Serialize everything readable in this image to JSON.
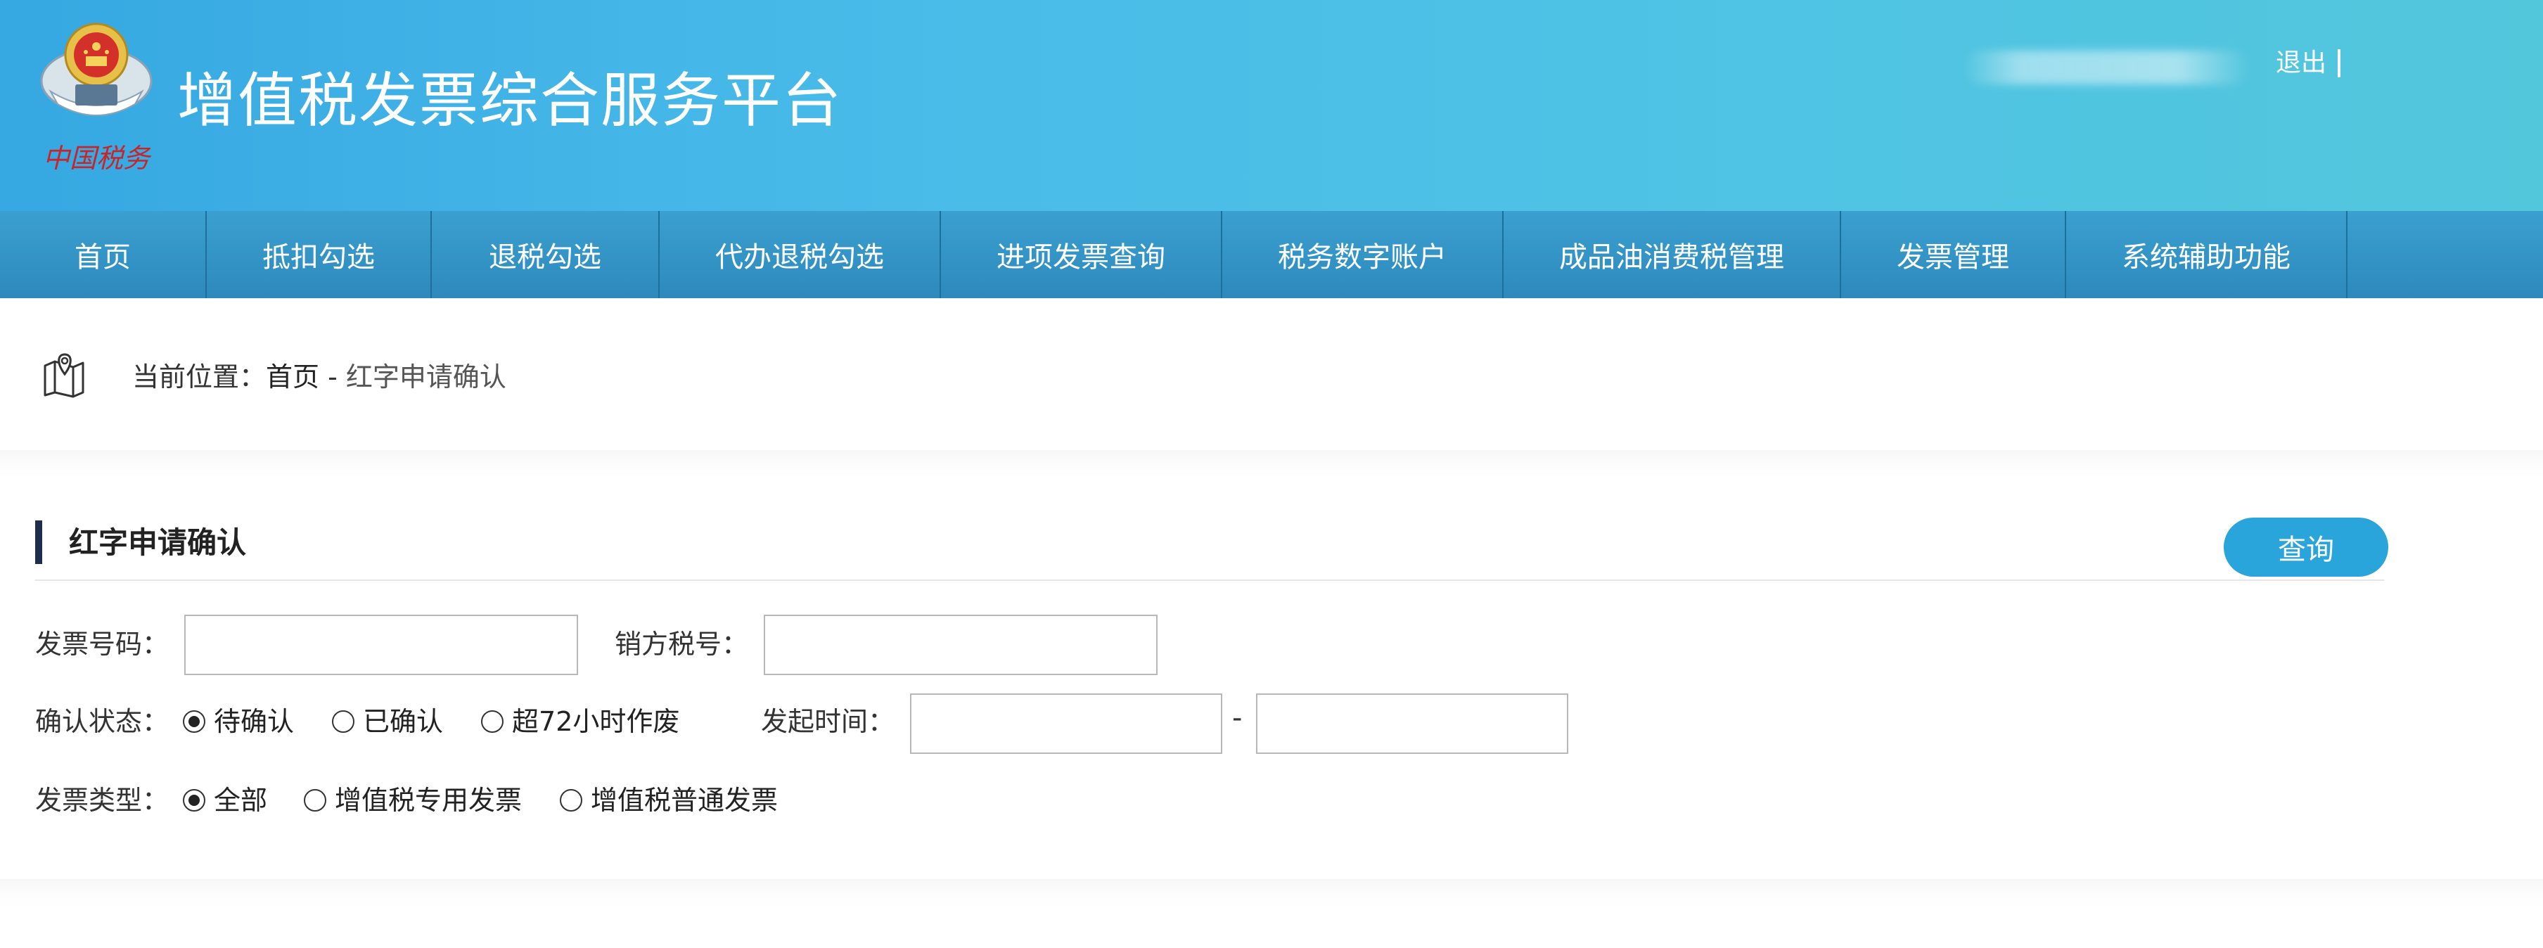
{
  "header": {
    "title": "增值税发票综合服务平台",
    "emblem_icon": "national-tax-emblem",
    "emblem_caption": "中国税务",
    "logout_label": "退出"
  },
  "nav": {
    "items": [
      {
        "label": "首页"
      },
      {
        "label": "抵扣勾选"
      },
      {
        "label": "退税勾选"
      },
      {
        "label": "代办退税勾选"
      },
      {
        "label": "进项发票查询"
      },
      {
        "label": "税务数字账户"
      },
      {
        "label": "成品油消费税管理"
      },
      {
        "label": "发票管理"
      },
      {
        "label": "系统辅助功能"
      }
    ]
  },
  "breadcrumb": {
    "icon": "map-location-icon",
    "prefix": "当前位置：",
    "home": "首页",
    "separator": " - ",
    "current": "红字申请确认"
  },
  "section": {
    "title": "红字申请确认",
    "query_label": "查询"
  },
  "form": {
    "invoice_number_label": "发票号码：",
    "invoice_number_value": "",
    "seller_tax_id_label": "销方税号：",
    "seller_tax_id_value": "",
    "confirm_status_label": "确认状态：",
    "confirm_status_options": [
      "待确认",
      "已确认",
      "超72小时作废"
    ],
    "confirm_status_selected": 0,
    "start_time_label": "发起时间：",
    "start_time_from": "",
    "start_time_to": "",
    "range_separator": "-",
    "invoice_type_label": "发票类型：",
    "invoice_type_options": [
      "全部",
      "增值税专用发票",
      "增值税普通发票"
    ],
    "invoice_type_selected": 0
  },
  "colors": {
    "header_gradient_start": "#36a8e2",
    "header_gradient_end": "#52c6db",
    "nav_bg": "#3aa0d0",
    "query_button": "#2aa5dc",
    "section_accent": "#1f2d4a"
  }
}
